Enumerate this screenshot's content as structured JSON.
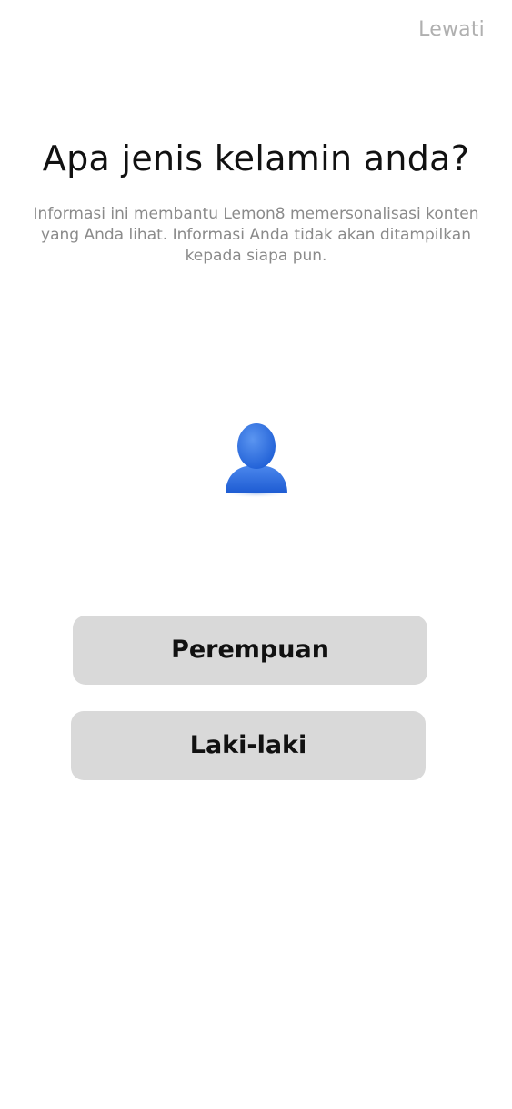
{
  "header": {
    "skip_label": "Lewati"
  },
  "main": {
    "title": "Apa jenis kelamin anda?",
    "subtitle": "Informasi ini membantu Lemon8 memersonalisasi konten yang Anda lihat. Informasi Anda tidak akan ditampilkan kepada siapa pun.",
    "avatar_icon": "user-silhouette-icon",
    "options": [
      {
        "label": "Perempuan"
      },
      {
        "label": "Laki-laki"
      }
    ]
  },
  "colors": {
    "background": "#ffffff",
    "skip_text": "#b0b0b0",
    "title_text": "#111111",
    "subtitle_text": "#8a8a8a",
    "button_bg": "#d9d9d9",
    "avatar_blue": "#2f6fe0"
  }
}
